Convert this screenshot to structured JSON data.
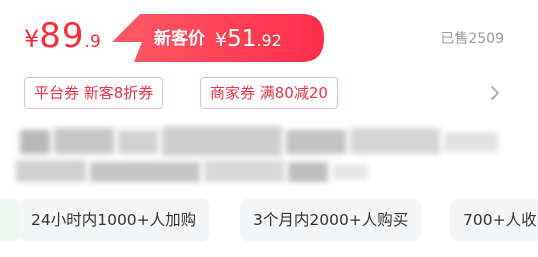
{
  "price": {
    "symbol": "¥",
    "integer": "89",
    "decimal": ".9",
    "color": "#ff2a3a"
  },
  "promo": {
    "label": "新客价",
    "symbol": "¥",
    "integer": "51",
    "decimal": ".92",
    "icon": "lightning-bolt-icon",
    "gradient": [
      "#ff4d5c",
      "#ff2e4a"
    ]
  },
  "sold": {
    "text": "已售2509"
  },
  "coupons": [
    {
      "text": "平台券 新客8折券"
    },
    {
      "text": "商家券 满80减20"
    }
  ],
  "coupon_more_icon": "chevron-right-icon",
  "tags": [
    {
      "text": "24小时内1000+人加购"
    },
    {
      "text": "3个月内2000+人购买"
    },
    {
      "text": "700+人收"
    }
  ]
}
